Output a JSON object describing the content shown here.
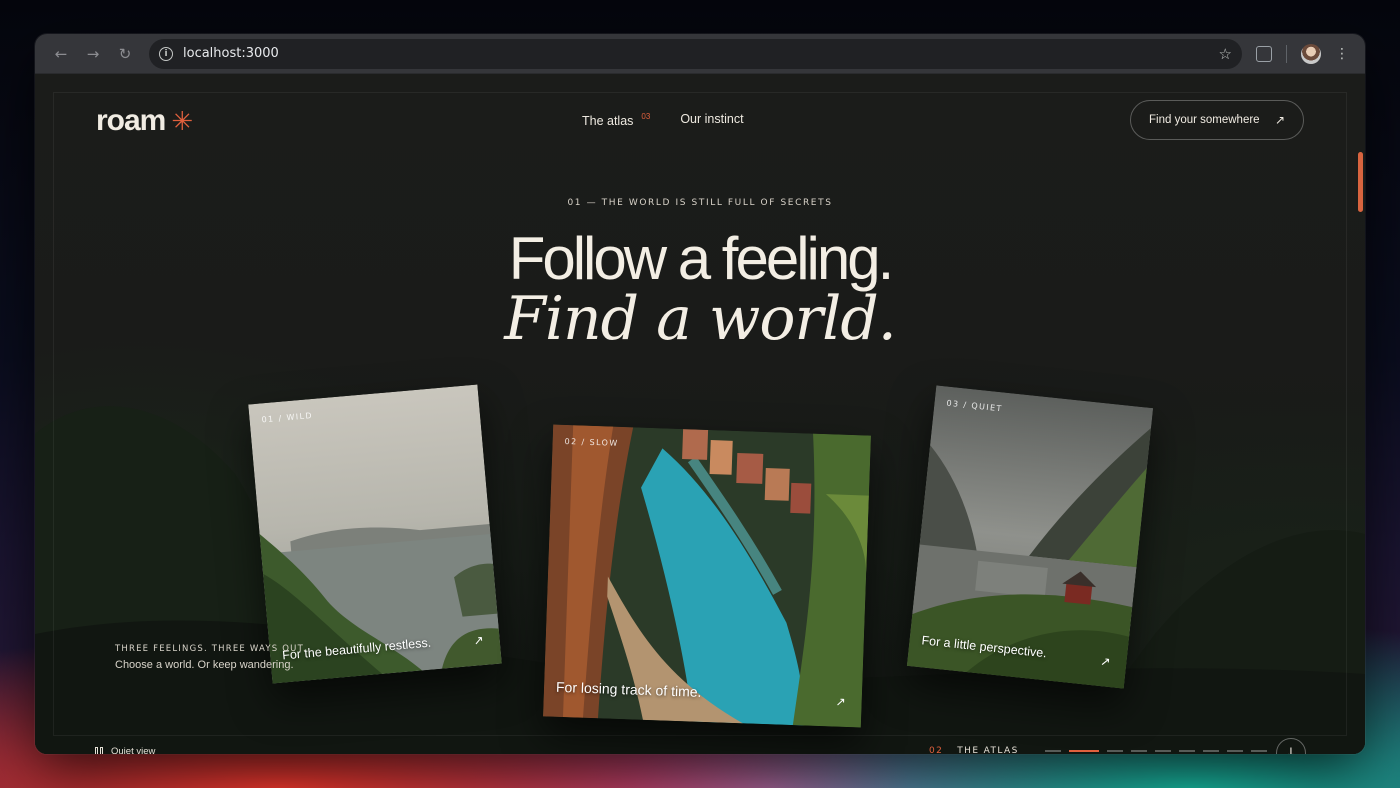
{
  "browser": {
    "url": "localhost:3000",
    "back_icon": "arrow-left-icon",
    "forward_icon": "arrow-right-icon",
    "reload_icon": "reload-icon"
  },
  "header": {
    "logo_text": "roam",
    "logo_mark": "✳",
    "nav": [
      {
        "label": "The atlas",
        "badge": "03"
      },
      {
        "label": "Our instinct"
      }
    ],
    "cta_label": "Find your somewhere",
    "cta_arrow": "↗"
  },
  "hero": {
    "eyebrow": "01 — THE WORLD IS STILL FULL OF SECRETS",
    "headline": "Follow a feeling.",
    "subheadline": "Find a world."
  },
  "cards": [
    {
      "tag": "01 / WILD",
      "caption": "For the beautifully restless.",
      "arrow": "↗"
    },
    {
      "tag": "02 / SLOW",
      "caption": "For losing track of time.",
      "arrow": "↗"
    },
    {
      "tag": "03 / QUIET",
      "caption": "For a little perspective.",
      "arrow": "↗"
    }
  ],
  "side_copy": {
    "kicker": "THREE FEELINGS. THREE WAYS OUT.",
    "line": "Choose a world. Or keep wandering."
  },
  "footer": {
    "quiet_view": "Quiet view",
    "section_number": "02",
    "section_label": "THE ATLAS",
    "dash_count": 9,
    "active_dash": 1,
    "scroll_down_arrow": "↓"
  },
  "colors": {
    "accent": "#e0603d",
    "text": "#f3eee4",
    "background": "#1a1b19"
  }
}
